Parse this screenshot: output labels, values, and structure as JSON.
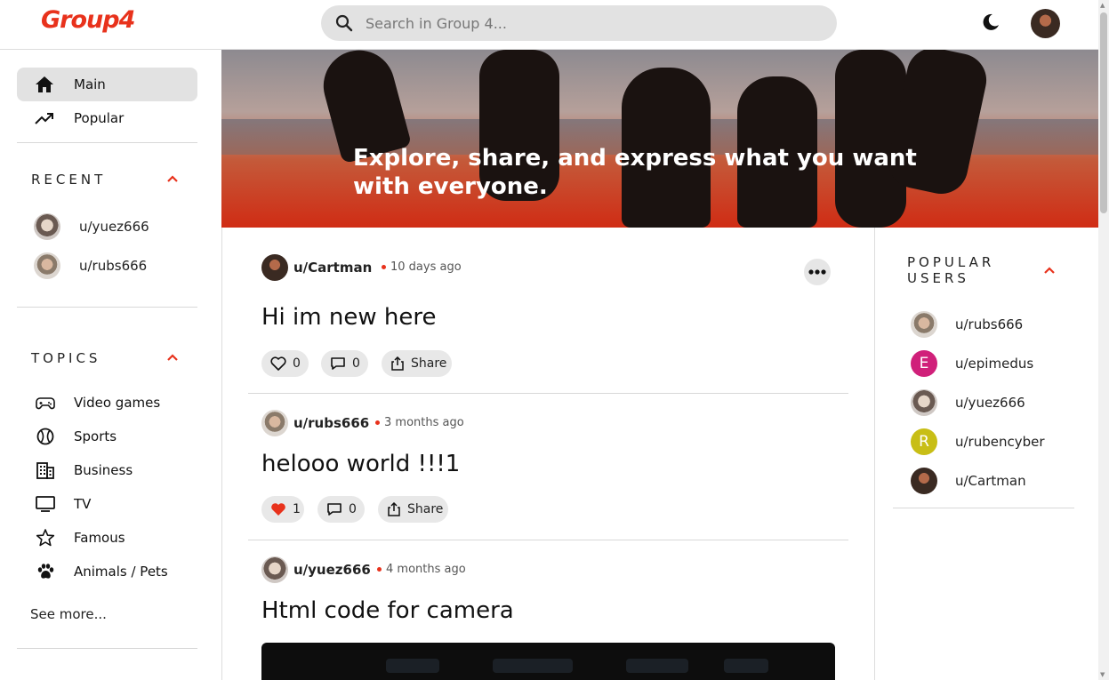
{
  "header": {
    "logo_text": "Group4",
    "logo_badge": "4",
    "search_placeholder": "Search in Group 4..."
  },
  "sidebar": {
    "nav": [
      {
        "label": "Main",
        "icon": "home-icon",
        "active": true
      },
      {
        "label": "Popular",
        "icon": "trending-icon",
        "active": false
      }
    ],
    "recent_title": "RECENT",
    "recent": [
      {
        "label": "u/yuez666"
      },
      {
        "label": "u/rubs666"
      }
    ],
    "topics_title": "TOPICS",
    "topics": [
      {
        "label": "Video games",
        "icon": "gamepad-icon"
      },
      {
        "label": "Sports",
        "icon": "ball-icon"
      },
      {
        "label": "Business",
        "icon": "building-icon"
      },
      {
        "label": "TV",
        "icon": "tv-icon"
      },
      {
        "label": "Famous",
        "icon": "star-icon"
      },
      {
        "label": "Animals / Pets",
        "icon": "paw-icon"
      }
    ],
    "see_more": "See more..."
  },
  "banner": {
    "text": "Explore, share, and express what you want with everyone."
  },
  "posts": [
    {
      "user": "u/Cartman",
      "time": "10 days ago",
      "title": "Hi im new here",
      "likes": "0",
      "comments": "0",
      "liked": false,
      "share": "Share"
    },
    {
      "user": "u/rubs666",
      "time": "3 months ago",
      "title": "helooo world !!!1",
      "likes": "1",
      "comments": "0",
      "liked": true,
      "share": "Share"
    },
    {
      "user": "u/yuez666",
      "time": "4 months ago",
      "title": "Html code for camera"
    }
  ],
  "popular_users": {
    "title": "POPULAR USERS",
    "users": [
      {
        "label": "u/rubs666",
        "initial": "",
        "color": ""
      },
      {
        "label": "u/epimedus",
        "initial": "E",
        "color": "#d0207a"
      },
      {
        "label": "u/yuez666",
        "initial": "",
        "color": ""
      },
      {
        "label": "u/rubencyber",
        "initial": "R",
        "color": "#c8be16"
      },
      {
        "label": "u/Cartman",
        "initial": "",
        "color": ""
      }
    ]
  },
  "colors": {
    "accent": "#e8321c",
    "liked_heart": "#e8321c"
  }
}
